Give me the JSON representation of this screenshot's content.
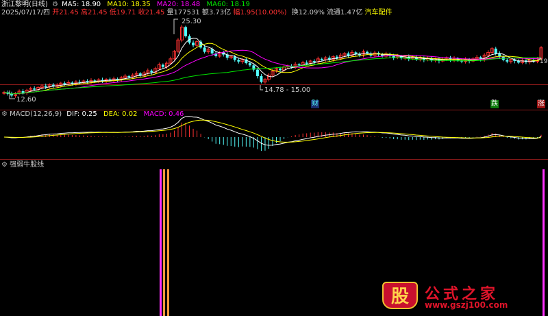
{
  "colors": {
    "background": "#000000",
    "up": "#ff3232",
    "down": "#54fcfc",
    "ma5": "#ffffff",
    "ma10": "#ffff00",
    "ma20": "#ff00ff",
    "ma60": "#00e600",
    "dif": "#ffffff",
    "dea": "#ffff00",
    "macd": "#ff00ff",
    "divider": "#8b1a1a"
  },
  "header": {
    "title": "浙江黎明(日线)",
    "ma5": "MA5: 18.90",
    "ma10": "MA10: 18.35",
    "ma20": "MA20: 18.48",
    "ma60": "MA60: 18.19",
    "date": "2025/07/17/四",
    "open": "开21.45",
    "high": "高21.45",
    "low": "低19.71",
    "close": "收21.45",
    "volume": "量177531",
    "amount": "额3.73亿",
    "change": "幅1.95(10.00%)",
    "turnover": "换12.09%",
    "float": "流通1.47亿",
    "industry": "汽车配件"
  },
  "annotations": {
    "high": "25.30",
    "low_left": "12.60",
    "low_mid": "14.78 - 15.00",
    "right_price": "19",
    "tag_cai": "财",
    "tag_die": "跌",
    "tag_zhang": "涨"
  },
  "macd_header": {
    "name": "MACD(12,26,9)",
    "dif": "DIF: 0.25",
    "dea": "DEA: 0.02",
    "macd": "MACD: 0.46"
  },
  "bottom_header": {
    "name": "强弱牛股线"
  },
  "watermark": {
    "logo": "股",
    "main": "公式之家",
    "url": "www.gszj100.com"
  },
  "chart_data": [
    {
      "type": "candlestick",
      "title": "浙江黎明(日线)",
      "ylim": [
        11.5,
        26.5
      ],
      "ohlc": [],
      "close": [
        13.2,
        12.9,
        12.6,
        13.0,
        13.4,
        13.1,
        13.6,
        13.9,
        13.7,
        14.1,
        14.4,
        14.2,
        14.6,
        14.3,
        14.5,
        14.9,
        14.7,
        15.0,
        14.8,
        15.1,
        15.0,
        15.3,
        15.1,
        15.4,
        15.2,
        15.5,
        15.3,
        15.6,
        15.4,
        15.7,
        15.5,
        15.9,
        16.2,
        16.0,
        16.4,
        16.7,
        16.3,
        16.8,
        17.2,
        16.9,
        17.6,
        18.3,
        17.9,
        18.6,
        19.4,
        20.8,
        22.9,
        25.3,
        23.6,
        22.4,
        21.9,
        22.6,
        21.5,
        20.7,
        21.2,
        20.4,
        19.9,
        20.6,
        20.2,
        19.6,
        19.8,
        19.2,
        18.9,
        19.3,
        18.6,
        18.2,
        17.4,
        16.2,
        15.1,
        15.6,
        16.4,
        17.1,
        17.6,
        17.3,
        17.9,
        18.1,
        17.8,
        18.4,
        18.2,
        18.7,
        18.5,
        19.0,
        18.8,
        19.4,
        19.2,
        19.6,
        19.3,
        19.8,
        19.5,
        20.1,
        20.4,
        20.0,
        20.6,
        20.3,
        20.1,
        20.7,
        20.4,
        20.0,
        20.5,
        20.2,
        19.9,
        20.3,
        20.0,
        19.6,
        19.9,
        19.5,
        19.8,
        19.4,
        19.7,
        19.3,
        19.6,
        19.2,
        19.5,
        19.1,
        19.4,
        19.0,
        19.3,
        19.6,
        19.2,
        19.5,
        19.1,
        18.9,
        19.3,
        19.0,
        19.4,
        19.7,
        19.3,
        20.1,
        20.6,
        21.3,
        20.4,
        19.8,
        19.2,
        18.9,
        19.3,
        19.0,
        18.7,
        19.1,
        18.8,
        19.2,
        18.9,
        19.5,
        21.45
      ],
      "annotations": [
        {
          "text": "25.30"
        },
        {
          "text": "12.60"
        },
        {
          "text": "14.78 - 15.00"
        }
      ],
      "series": [
        {
          "name": "MA5"
        },
        {
          "name": "MA10"
        },
        {
          "name": "MA20"
        },
        {
          "name": "MA60"
        }
      ]
    },
    {
      "type": "bar",
      "title": "MACD(12,26,9)",
      "series": [
        {
          "name": "DIF"
        },
        {
          "name": "DEA"
        },
        {
          "name": "MACD"
        }
      ]
    },
    {
      "type": "bar",
      "title": "强弱牛股线",
      "bars": [
        {
          "color": "#ff30ff"
        },
        {
          "color": "#ff9a3a"
        },
        {
          "color": "#ff9a3a"
        },
        {
          "color": "#ff30ff"
        }
      ]
    }
  ]
}
